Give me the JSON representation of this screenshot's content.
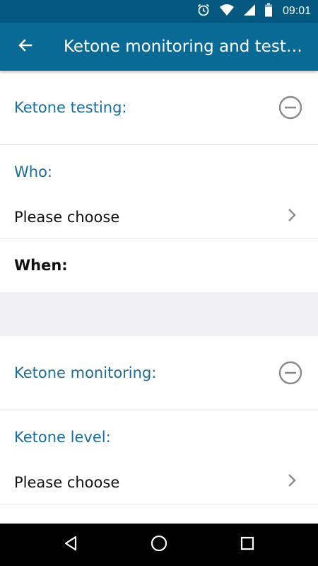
{
  "status_bar": {
    "time": "09:01",
    "icons": [
      "alarm-icon",
      "wifi-icon",
      "cell-signal-icon",
      "battery-icon"
    ]
  },
  "app_bar": {
    "title": "Ketone monitoring and testi…",
    "back_icon": "arrow-back-icon"
  },
  "sections": [
    {
      "title": "Ketone testing:",
      "collapse_icon": "minus-circle-icon",
      "field_label": "Who:",
      "field_value": "Please choose",
      "extra_label": "When:"
    },
    {
      "title": "Ketone monitoring:",
      "collapse_icon": "minus-circle-icon",
      "field_label": "Ketone level:",
      "field_value": "Please choose"
    }
  ],
  "nav_bar": {
    "buttons": [
      "back-triangle-icon",
      "home-circle-icon",
      "recents-square-icon"
    ]
  },
  "colors": {
    "status_bar": "#05587f",
    "app_bar": "#0a6a96",
    "accent_text": "#1b6d97",
    "divider_band": "#f0eff4"
  }
}
